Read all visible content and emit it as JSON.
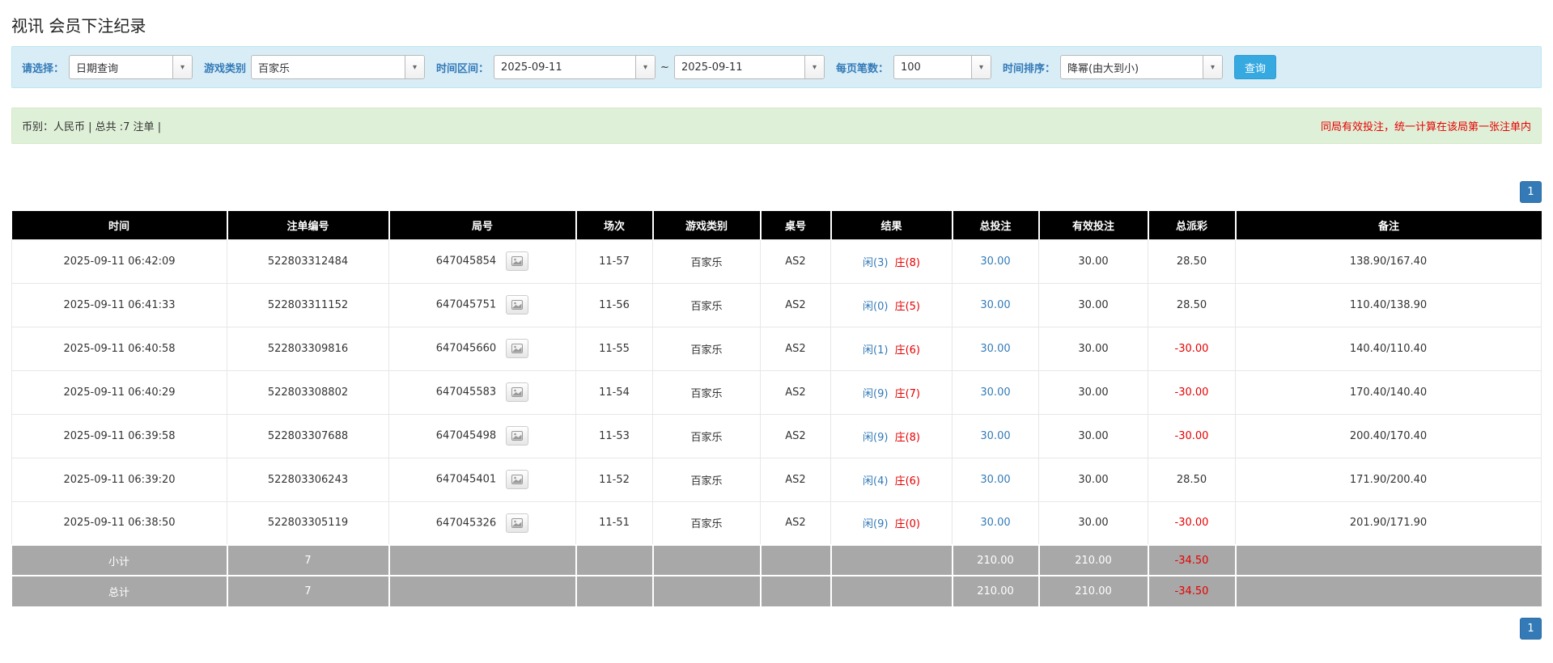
{
  "page": {
    "title": "视讯 会员下注纪录"
  },
  "icons": {
    "combo_arrow": "▾"
  },
  "filters": {
    "select_label": "请选择：",
    "select_value": "日期查询",
    "game_type_label": "游戏类别",
    "game_type_value": "百家乐",
    "time_range_label": "时间区间：",
    "date_from": "2025-09-11",
    "date_separator": "~",
    "date_to": "2025-09-11",
    "page_size_label": "每页笔数：",
    "page_size_value": "100",
    "sort_label": "时间排序：",
    "sort_value": "降幂(由大到小)",
    "search_button": "查询"
  },
  "summary": {
    "left": "币别：人民币 | 总共 :7 注单 |",
    "right": "同局有效投注，统一计算在该局第一张注单内"
  },
  "pagination": {
    "page": "1"
  },
  "table": {
    "headers": [
      "时间",
      "注单编号",
      "局号",
      "场次",
      "游戏类别",
      "桌号",
      "结果",
      "总投注",
      "有效投注",
      "总派彩",
      "备注"
    ],
    "rows": [
      {
        "time": "2025-09-11 06:42:09",
        "bet_id": "522803312484",
        "round_id": "647045854",
        "session": "11-57",
        "game": "百家乐",
        "table_no": "AS2",
        "result_player": "闲(3)",
        "result_banker": "庄(8)",
        "total_bet": "30.00",
        "valid_bet": "30.00",
        "payout": "28.50",
        "note": "138.90/167.40"
      },
      {
        "time": "2025-09-11 06:41:33",
        "bet_id": "522803311152",
        "round_id": "647045751",
        "session": "11-56",
        "game": "百家乐",
        "table_no": "AS2",
        "result_player": "闲(0)",
        "result_banker": "庄(5)",
        "total_bet": "30.00",
        "valid_bet": "30.00",
        "payout": "28.50",
        "note": "110.40/138.90"
      },
      {
        "time": "2025-09-11 06:40:58",
        "bet_id": "522803309816",
        "round_id": "647045660",
        "session": "11-55",
        "game": "百家乐",
        "table_no": "AS2",
        "result_player": "闲(1)",
        "result_banker": "庄(6)",
        "total_bet": "30.00",
        "valid_bet": "30.00",
        "payout": "-30.00",
        "note": "140.40/110.40"
      },
      {
        "time": "2025-09-11 06:40:29",
        "bet_id": "522803308802",
        "round_id": "647045583",
        "session": "11-54",
        "game": "百家乐",
        "table_no": "AS2",
        "result_player": "闲(9)",
        "result_banker": "庄(7)",
        "total_bet": "30.00",
        "valid_bet": "30.00",
        "payout": "-30.00",
        "note": "170.40/140.40"
      },
      {
        "time": "2025-09-11 06:39:58",
        "bet_id": "522803307688",
        "round_id": "647045498",
        "session": "11-53",
        "game": "百家乐",
        "table_no": "AS2",
        "result_player": "闲(9)",
        "result_banker": "庄(8)",
        "total_bet": "30.00",
        "valid_bet": "30.00",
        "payout": "-30.00",
        "note": "200.40/170.40"
      },
      {
        "time": "2025-09-11 06:39:20",
        "bet_id": "522803306243",
        "round_id": "647045401",
        "session": "11-52",
        "game": "百家乐",
        "table_no": "AS2",
        "result_player": "闲(4)",
        "result_banker": "庄(6)",
        "total_bet": "30.00",
        "valid_bet": "30.00",
        "payout": "28.50",
        "note": "171.90/200.40"
      },
      {
        "time": "2025-09-11 06:38:50",
        "bet_id": "522803305119",
        "round_id": "647045326",
        "session": "11-51",
        "game": "百家乐",
        "table_no": "AS2",
        "result_player": "闲(9)",
        "result_banker": "庄(0)",
        "total_bet": "30.00",
        "valid_bet": "30.00",
        "payout": "-30.00",
        "note": "201.90/171.90"
      }
    ],
    "subtotal": {
      "label": "小计",
      "count": "7",
      "total_bet": "210.00",
      "valid_bet": "210.00",
      "payout": "-34.50"
    },
    "total": {
      "label": "总计",
      "count": "7",
      "total_bet": "210.00",
      "valid_bet": "210.00",
      "payout": "-34.50"
    }
  }
}
